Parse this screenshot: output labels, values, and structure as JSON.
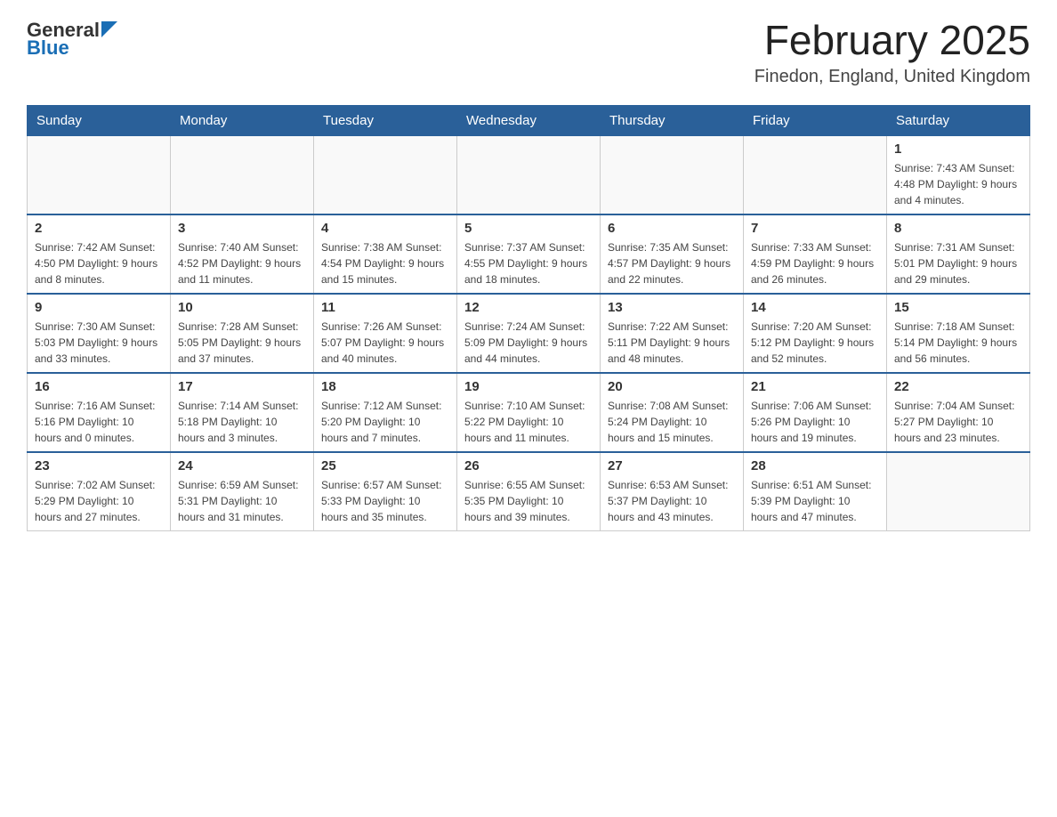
{
  "header": {
    "logo_general": "General",
    "logo_blue": "Blue",
    "title": "February 2025",
    "location": "Finedon, England, United Kingdom"
  },
  "weekdays": [
    "Sunday",
    "Monday",
    "Tuesday",
    "Wednesday",
    "Thursday",
    "Friday",
    "Saturday"
  ],
  "weeks": [
    [
      {
        "day": "",
        "info": ""
      },
      {
        "day": "",
        "info": ""
      },
      {
        "day": "",
        "info": ""
      },
      {
        "day": "",
        "info": ""
      },
      {
        "day": "",
        "info": ""
      },
      {
        "day": "",
        "info": ""
      },
      {
        "day": "1",
        "info": "Sunrise: 7:43 AM\nSunset: 4:48 PM\nDaylight: 9 hours\nand 4 minutes."
      }
    ],
    [
      {
        "day": "2",
        "info": "Sunrise: 7:42 AM\nSunset: 4:50 PM\nDaylight: 9 hours\nand 8 minutes."
      },
      {
        "day": "3",
        "info": "Sunrise: 7:40 AM\nSunset: 4:52 PM\nDaylight: 9 hours\nand 11 minutes."
      },
      {
        "day": "4",
        "info": "Sunrise: 7:38 AM\nSunset: 4:54 PM\nDaylight: 9 hours\nand 15 minutes."
      },
      {
        "day": "5",
        "info": "Sunrise: 7:37 AM\nSunset: 4:55 PM\nDaylight: 9 hours\nand 18 minutes."
      },
      {
        "day": "6",
        "info": "Sunrise: 7:35 AM\nSunset: 4:57 PM\nDaylight: 9 hours\nand 22 minutes."
      },
      {
        "day": "7",
        "info": "Sunrise: 7:33 AM\nSunset: 4:59 PM\nDaylight: 9 hours\nand 26 minutes."
      },
      {
        "day": "8",
        "info": "Sunrise: 7:31 AM\nSunset: 5:01 PM\nDaylight: 9 hours\nand 29 minutes."
      }
    ],
    [
      {
        "day": "9",
        "info": "Sunrise: 7:30 AM\nSunset: 5:03 PM\nDaylight: 9 hours\nand 33 minutes."
      },
      {
        "day": "10",
        "info": "Sunrise: 7:28 AM\nSunset: 5:05 PM\nDaylight: 9 hours\nand 37 minutes."
      },
      {
        "day": "11",
        "info": "Sunrise: 7:26 AM\nSunset: 5:07 PM\nDaylight: 9 hours\nand 40 minutes."
      },
      {
        "day": "12",
        "info": "Sunrise: 7:24 AM\nSunset: 5:09 PM\nDaylight: 9 hours\nand 44 minutes."
      },
      {
        "day": "13",
        "info": "Sunrise: 7:22 AM\nSunset: 5:11 PM\nDaylight: 9 hours\nand 48 minutes."
      },
      {
        "day": "14",
        "info": "Sunrise: 7:20 AM\nSunset: 5:12 PM\nDaylight: 9 hours\nand 52 minutes."
      },
      {
        "day": "15",
        "info": "Sunrise: 7:18 AM\nSunset: 5:14 PM\nDaylight: 9 hours\nand 56 minutes."
      }
    ],
    [
      {
        "day": "16",
        "info": "Sunrise: 7:16 AM\nSunset: 5:16 PM\nDaylight: 10 hours\nand 0 minutes."
      },
      {
        "day": "17",
        "info": "Sunrise: 7:14 AM\nSunset: 5:18 PM\nDaylight: 10 hours\nand 3 minutes."
      },
      {
        "day": "18",
        "info": "Sunrise: 7:12 AM\nSunset: 5:20 PM\nDaylight: 10 hours\nand 7 minutes."
      },
      {
        "day": "19",
        "info": "Sunrise: 7:10 AM\nSunset: 5:22 PM\nDaylight: 10 hours\nand 11 minutes."
      },
      {
        "day": "20",
        "info": "Sunrise: 7:08 AM\nSunset: 5:24 PM\nDaylight: 10 hours\nand 15 minutes."
      },
      {
        "day": "21",
        "info": "Sunrise: 7:06 AM\nSunset: 5:26 PM\nDaylight: 10 hours\nand 19 minutes."
      },
      {
        "day": "22",
        "info": "Sunrise: 7:04 AM\nSunset: 5:27 PM\nDaylight: 10 hours\nand 23 minutes."
      }
    ],
    [
      {
        "day": "23",
        "info": "Sunrise: 7:02 AM\nSunset: 5:29 PM\nDaylight: 10 hours\nand 27 minutes."
      },
      {
        "day": "24",
        "info": "Sunrise: 6:59 AM\nSunset: 5:31 PM\nDaylight: 10 hours\nand 31 minutes."
      },
      {
        "day": "25",
        "info": "Sunrise: 6:57 AM\nSunset: 5:33 PM\nDaylight: 10 hours\nand 35 minutes."
      },
      {
        "day": "26",
        "info": "Sunrise: 6:55 AM\nSunset: 5:35 PM\nDaylight: 10 hours\nand 39 minutes."
      },
      {
        "day": "27",
        "info": "Sunrise: 6:53 AM\nSunset: 5:37 PM\nDaylight: 10 hours\nand 43 minutes."
      },
      {
        "day": "28",
        "info": "Sunrise: 6:51 AM\nSunset: 5:39 PM\nDaylight: 10 hours\nand 47 minutes."
      },
      {
        "day": "",
        "info": ""
      }
    ]
  ]
}
